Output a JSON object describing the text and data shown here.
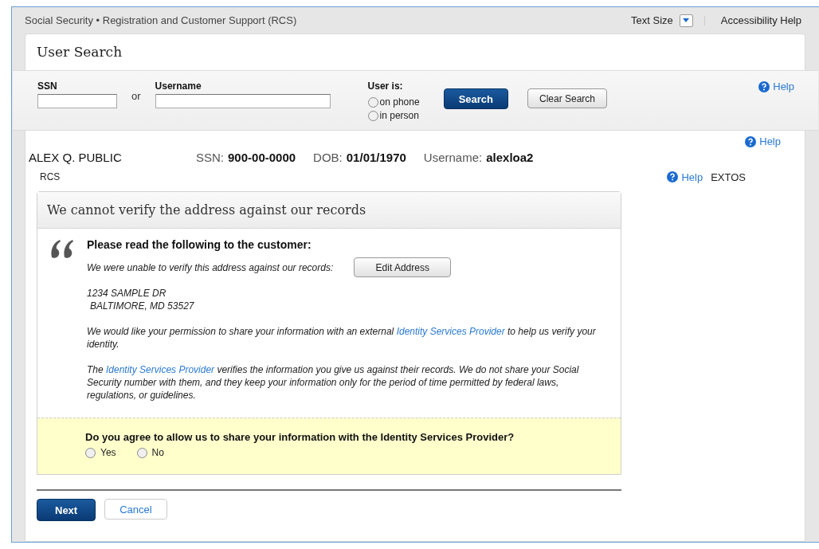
{
  "header": {
    "title": "Social Security • Registration and Customer Support (RCS)",
    "text_size": "Text Size",
    "accessibility": "Accessibility Help"
  },
  "search": {
    "title": "User Search",
    "ssn_label": "SSN",
    "or": "or",
    "username_label": "Username",
    "user_is": "User is:",
    "user_options": [
      {
        "label": "on phone",
        "selected": false
      },
      {
        "label": "in person",
        "selected": false
      }
    ],
    "search_button": "Search",
    "clear_button": "Clear Search",
    "help": "Help"
  },
  "customer": {
    "name": "ALEX Q. PUBLIC",
    "ssn_label": "SSN:",
    "ssn": "900-00-0000",
    "dob_label": "DOB:",
    "dob": "01/01/1970",
    "username_label": "Username:",
    "username": "alexloa2",
    "help": "Help"
  },
  "breadcrumb": "RCS",
  "side_help": "Help",
  "side_label": "EXTOS",
  "panel": {
    "title": "We cannot verify the address against our records",
    "intro": "Please read the following to the customer:",
    "unable": "We were unable to verify this address against our records:",
    "edit_button": "Edit Address",
    "address": [
      "1234 SAMPLE DR",
      "BALTIMORE, MD 53527"
    ],
    "paragraphs": [
      {
        "before": "We would like your permission to share your information with an external ",
        "link": "Identity Services Provider",
        "after": " to help us verify your identity."
      },
      {
        "before": "The ",
        "link": "Identity Services Provider",
        "after": " verifies the information you give us against their records. We do not share your Social Security number with them, and they keep your information only for the period of time permitted by federal laws, regulations, or guidelines."
      }
    ],
    "question": "Do you agree to allow us to share your information with the Identity Services Provider?",
    "answers": [
      {
        "label": "Yes",
        "selected": false
      },
      {
        "label": "No",
        "selected": false
      }
    ]
  },
  "next_button": "Next",
  "cancel_button": "Cancel"
}
